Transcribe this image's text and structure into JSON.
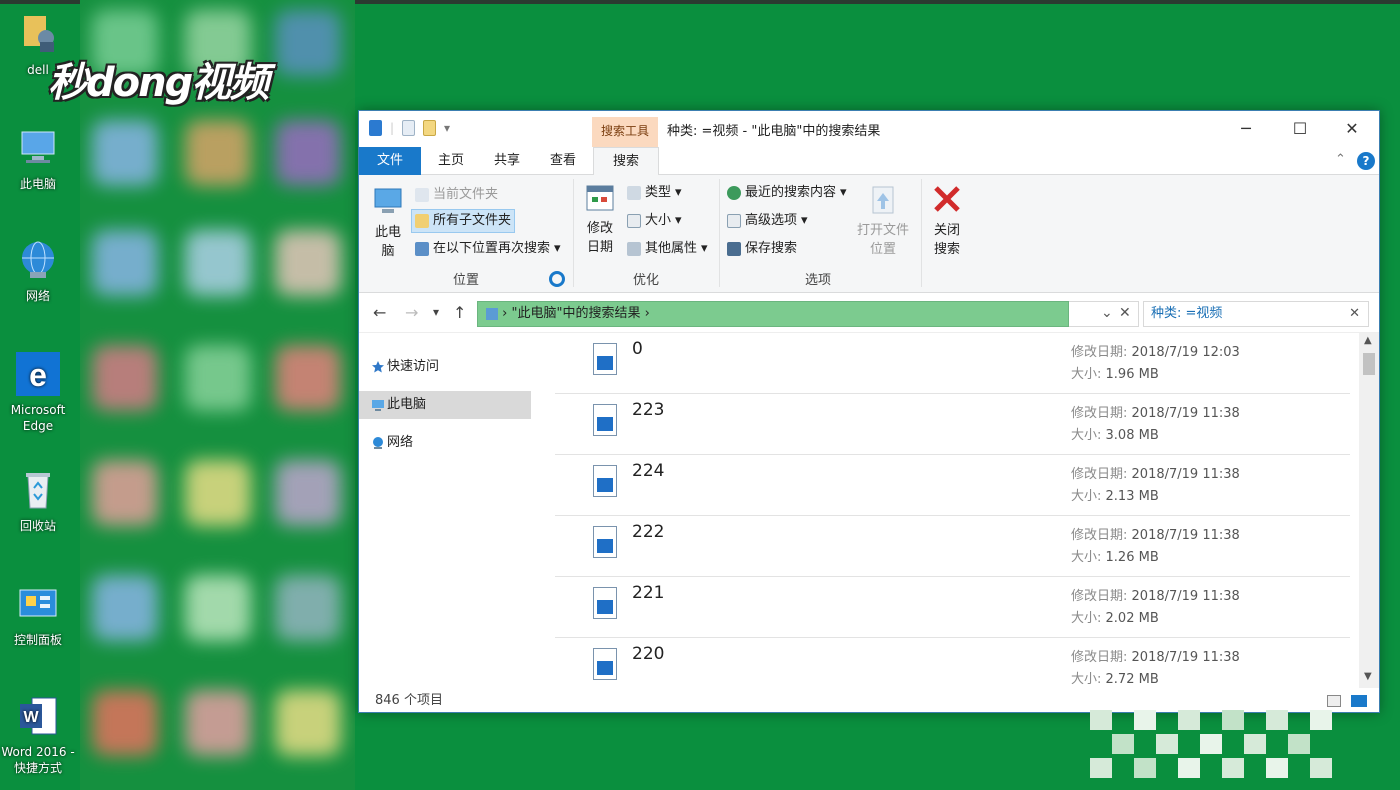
{
  "desktop": {
    "watermark": "秒dong视频",
    "icons": [
      {
        "label": "dell",
        "icon": "user-folder-icon"
      },
      {
        "label": "此电脑",
        "icon": "this-pc-icon"
      },
      {
        "label": "网络",
        "icon": "network-icon"
      },
      {
        "label": "Microsoft Edge",
        "icon": "edge-icon"
      },
      {
        "label": "回收站",
        "icon": "recycle-bin-icon"
      },
      {
        "label": "控制面板",
        "icon": "control-panel-icon"
      },
      {
        "label": "Word 2016 - 快捷方式",
        "icon": "word-icon"
      }
    ]
  },
  "window": {
    "context_tab": "搜索工具",
    "title": "种类: =视频 - \"此电脑\"中的搜索结果",
    "controls": {
      "minimize": "─",
      "maximize": "☐",
      "close": "✕"
    },
    "tabs": [
      "文件",
      "主页",
      "共享",
      "查看",
      "搜索"
    ],
    "active_tab": "搜索"
  },
  "ribbon": {
    "location": {
      "label": "位置",
      "this_pc": "此电脑",
      "current_folder": "当前文件夹",
      "all_subfolders": "所有子文件夹",
      "search_again": "在以下位置再次搜索"
    },
    "refine": {
      "label": "优化",
      "date_modified": "修改日期",
      "kind": "类型",
      "size": "大小",
      "other_props": "其他属性"
    },
    "options": {
      "label": "选项",
      "recent_searches": "最近的搜索内容",
      "advanced": "高级选项",
      "save_search": "保存搜索",
      "open_file_location": "打开文件位置"
    },
    "close": {
      "label": "关闭搜索"
    }
  },
  "address": {
    "path": "\"此电脑\"中的搜索结果",
    "search_value": "种类: =视频"
  },
  "nav": {
    "items": [
      {
        "label": "快速访问",
        "icon": "star-icon"
      },
      {
        "label": "此电脑",
        "icon": "pc-icon"
      },
      {
        "label": "网络",
        "icon": "network-icon"
      }
    ]
  },
  "files": [
    {
      "name": "0",
      "modified_label": "修改日期:",
      "modified": "2018/7/19 12:03",
      "size_label": "大小:",
      "size": "1.96 MB"
    },
    {
      "name": "223",
      "modified_label": "修改日期:",
      "modified": "2018/7/19 11:38",
      "size_label": "大小:",
      "size": "3.08 MB"
    },
    {
      "name": "224",
      "modified_label": "修改日期:",
      "modified": "2018/7/19 11:38",
      "size_label": "大小:",
      "size": "2.13 MB"
    },
    {
      "name": "222",
      "modified_label": "修改日期:",
      "modified": "2018/7/19 11:38",
      "size_label": "大小:",
      "size": "1.26 MB"
    },
    {
      "name": "221",
      "modified_label": "修改日期:",
      "modified": "2018/7/19 11:38",
      "size_label": "大小:",
      "size": "2.02 MB"
    },
    {
      "name": "220",
      "modified_label": "修改日期:",
      "modified": "2018/7/19 11:38",
      "size_label": "大小:",
      "size": "2.72 MB"
    }
  ],
  "status": {
    "count": "846 个项目"
  },
  "colors": {
    "desktop_bg": "#0a8f3e",
    "file_tab": "#1979ca",
    "context_tab": "#fbd9bf",
    "address_highlight": "#7ccb8f"
  }
}
